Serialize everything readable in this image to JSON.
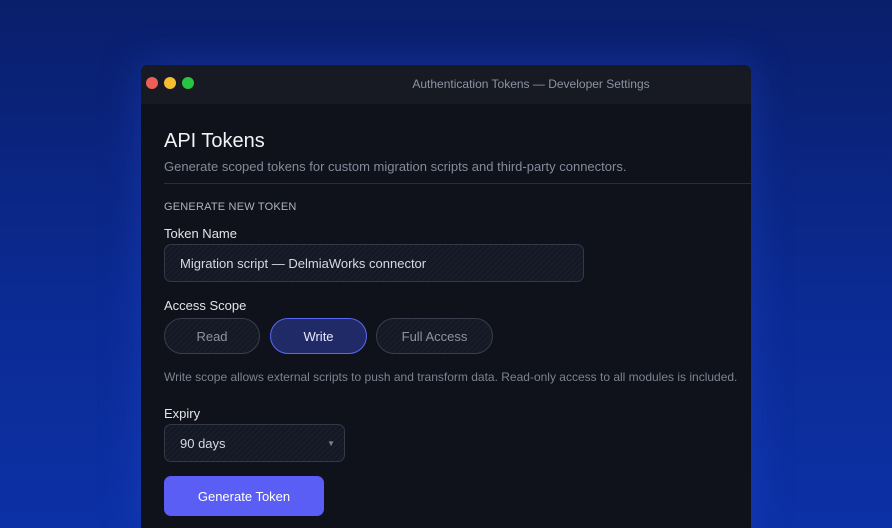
{
  "window": {
    "title": "Authentication Tokens — Developer Settings"
  },
  "page": {
    "title": "API Tokens",
    "subtitle": "Generate scoped tokens for custom migration scripts and third-party connectors."
  },
  "form": {
    "section_heading": "GENERATE NEW TOKEN",
    "token_name": {
      "label": "Token Name",
      "value": "Migration script — DelmiaWorks connector"
    },
    "access_scope": {
      "label": "Access Scope",
      "options": [
        "Read",
        "Write",
        "Full Access"
      ],
      "selected": "Write",
      "help_text": "Write scope allows external scripts to push and transform data. Read-only access to all modules is included."
    },
    "expiry": {
      "label": "Expiry",
      "selected": "90 days",
      "icon": "chevron-down-icon"
    },
    "generate_label": "Generate Token"
  },
  "colors": {
    "accent": "#5b5ef4",
    "selected_pill_border": "#5b67f5",
    "selected_pill_bg": "#202a66",
    "window_bg": "#0f121a",
    "titlebar_bg": "#171a23",
    "traffic_red": "#ed5f57",
    "traffic_yellow": "#f5bd2f",
    "traffic_green": "#29c440"
  }
}
